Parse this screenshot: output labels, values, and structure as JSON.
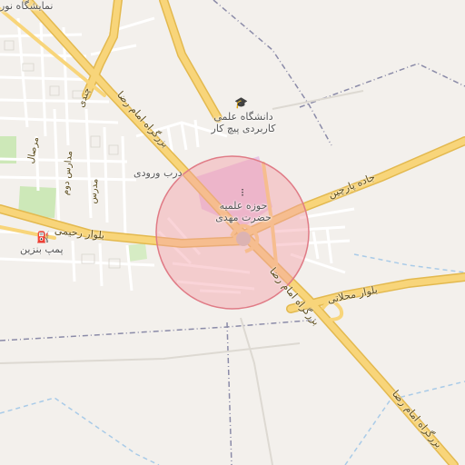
{
  "colors": {
    "background": "#f3f0ec",
    "major_road": "#f8d57a",
    "major_road_casing": "#e3b94f",
    "minor_road": "#ffffff",
    "park": "#cde8b8",
    "highlight_area": "#e8c7e6",
    "radius_fill": "#f3a0a8",
    "radius_stroke": "#e07b86",
    "boundary": "#8b8ba8",
    "water": "#a9cbe8"
  },
  "labels": {
    "top_left": "نمایشگاه نور",
    "university": "دانشگاه علمی کاربردی پیچ کار",
    "dorb": "درب ورودی",
    "seminary": "حوزه علمیه حضرت مهدی",
    "gas_station": "پمپ بنزین",
    "rahimi": "بلوار رحیمی",
    "parchin": "جاده پارچین",
    "mahallati": "بلوار محلاتی",
    "imam_reza_upper": "بزرگراه امام رضا",
    "imam_reza_middle": "بزرگراه امام رضا",
    "imam_reza_lower": "بزرگراه امام رضا",
    "morsal": "مرصال",
    "madares_1": "مدارس دوم",
    "madares_2": "مدرس",
    "hendi": "چندی"
  },
  "icons": {
    "university": "graduation-cap-icon",
    "seminary": "religious-icon",
    "gas_station": "fuel-pump-icon"
  }
}
